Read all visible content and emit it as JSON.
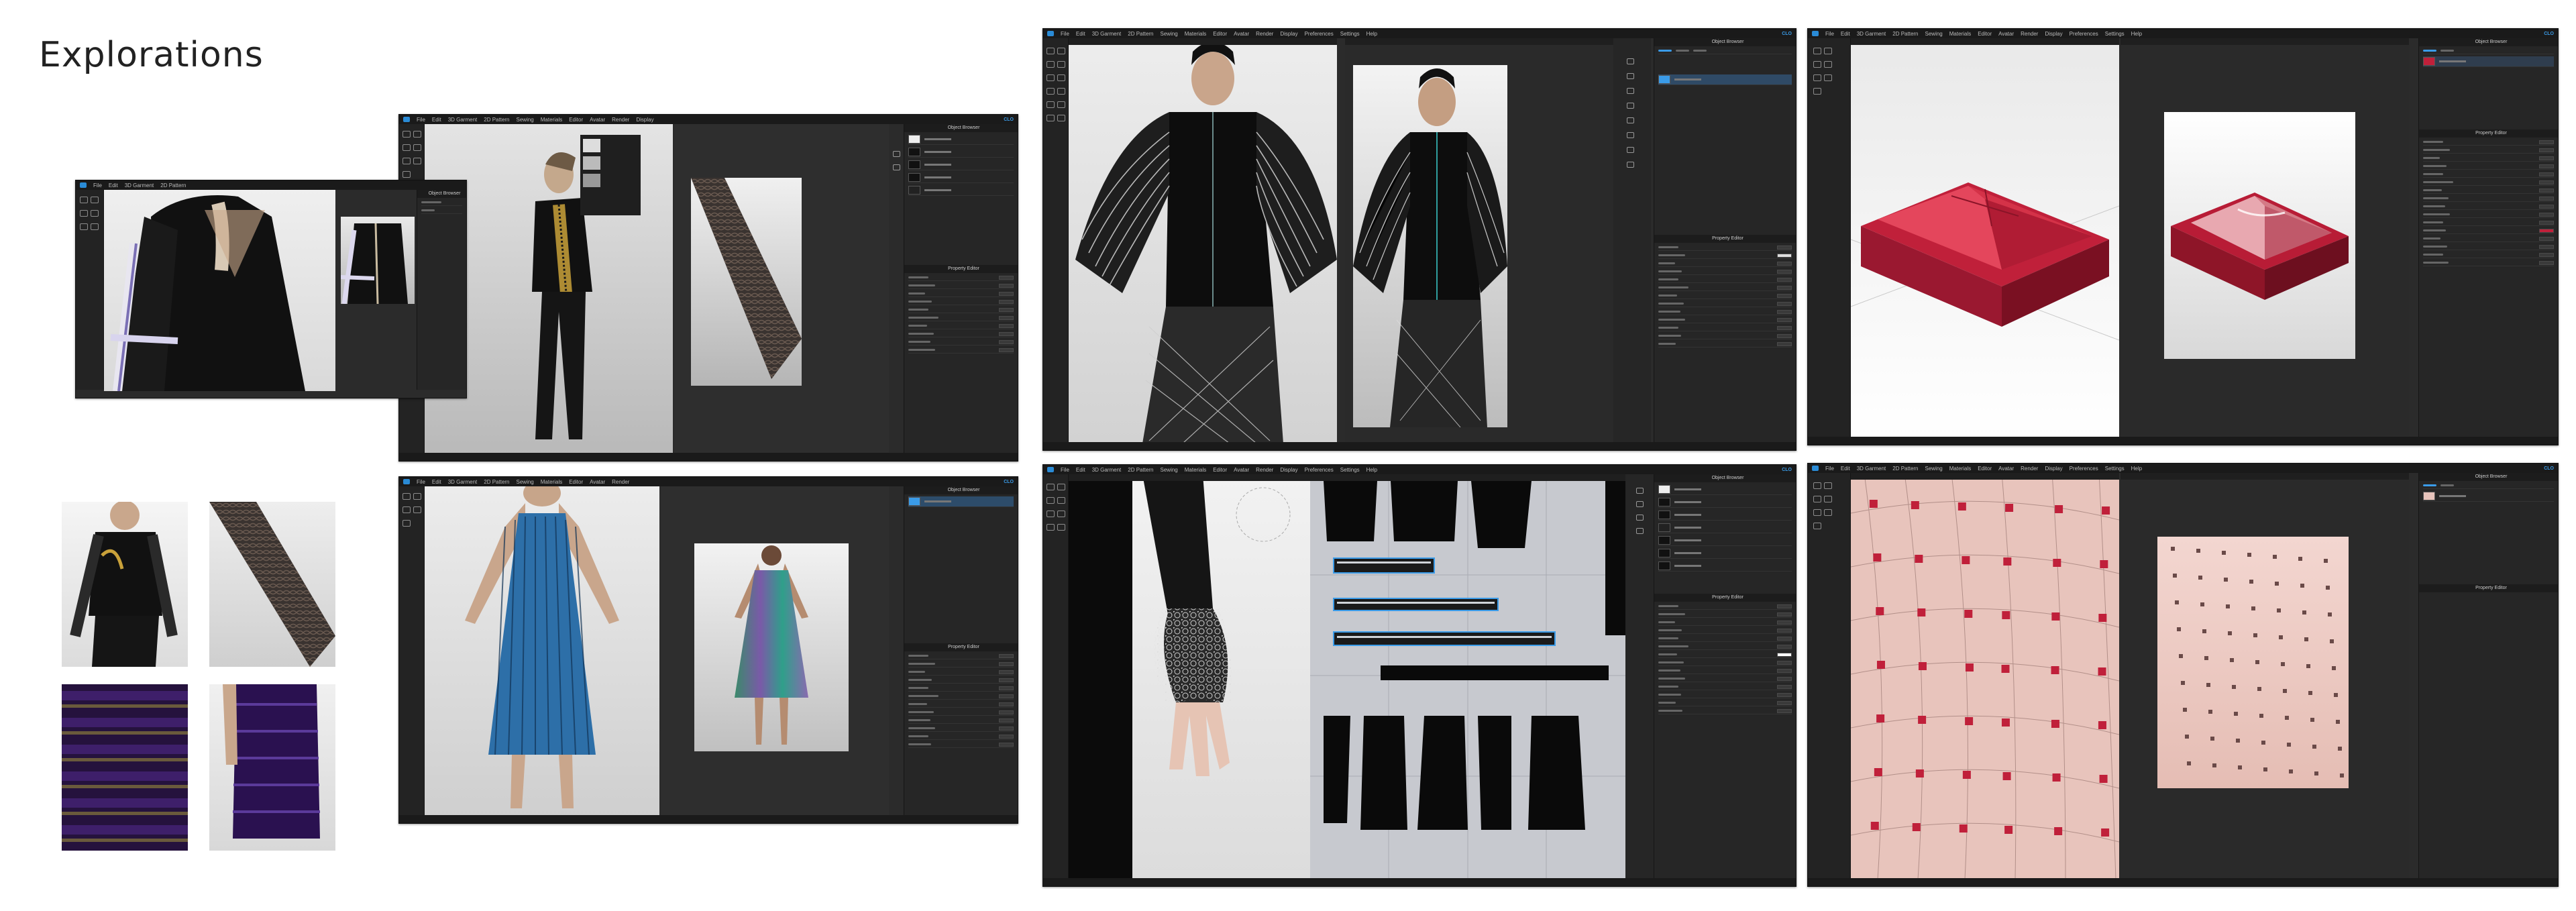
{
  "page": {
    "title": "Explorations"
  },
  "colors": {
    "app_bg": "#2b2b2b",
    "menubar": "#1a1a1a",
    "accent": "#3a9be8",
    "fabric_red": "#c0203a",
    "render_bg": "#cfcfcf"
  },
  "app": {
    "menu_items": [
      "File",
      "Edit",
      "3D Garment",
      "2D Pattern",
      "Sewing",
      "Materials",
      "Editor",
      "Avatar",
      "Render",
      "Display",
      "Preferences",
      "Settings",
      "Help"
    ],
    "brand": "CLO"
  },
  "windows": [
    {
      "id": "w1",
      "viewport_header": "",
      "render_header": ""
    },
    {
      "id": "w2",
      "viewport_header": "",
      "render_header": ""
    },
    {
      "id": "w3",
      "viewport_header": "",
      "render_header": ""
    },
    {
      "id": "w4",
      "viewport_header": "",
      "render_header": ""
    },
    {
      "id": "w5",
      "viewport_header": "",
      "render_header": ""
    },
    {
      "id": "w6",
      "viewport_header": "",
      "render_header": ""
    },
    {
      "id": "w7",
      "viewport_header": "",
      "render_header": ""
    }
  ],
  "panels": {
    "object_browser": "Object Browser",
    "property_editor": "Property Editor"
  },
  "icons": [
    "select-icon",
    "move-icon",
    "rotate-icon",
    "pin-icon",
    "brush-icon",
    "layer-icon",
    "visibility-icon"
  ]
}
